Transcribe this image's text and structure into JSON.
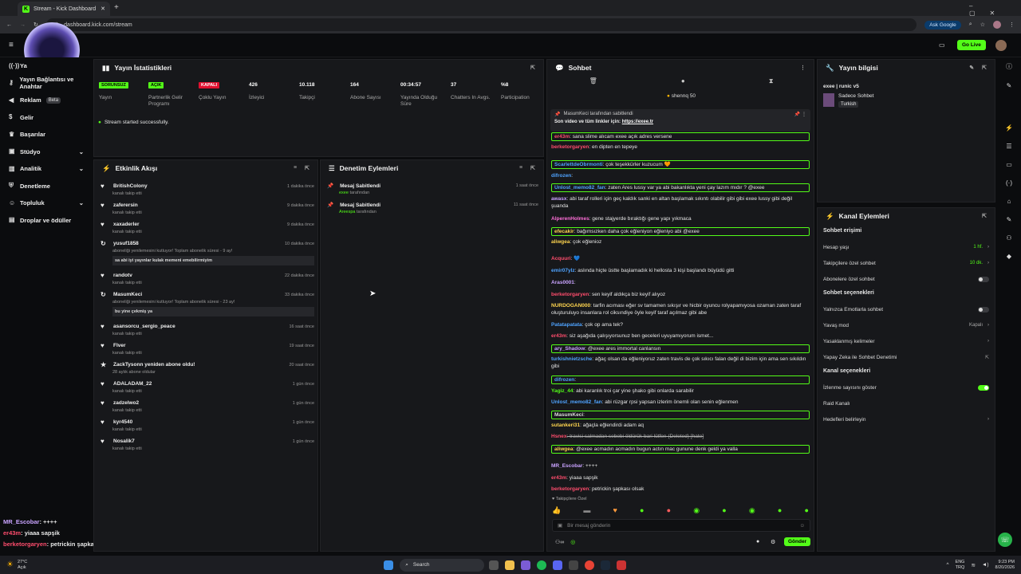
{
  "browser": {
    "tab_title": "Stream - Kick Dashboard",
    "url": "dashboard.kick.com/stream",
    "ask_google": "Ask Google"
  },
  "topbar": {
    "go_live": "Go Live"
  },
  "sidebar": {
    "items": [
      {
        "label": "Yayın Bağlantısı ve Anahtar",
        "icon": "key-icon"
      },
      {
        "label": "Reklam",
        "badge": "Beta",
        "icon": "megaphone-icon"
      },
      {
        "label": "Gelir",
        "icon": "dollar-icon"
      },
      {
        "label": "Başarılar",
        "icon": "trophy-icon"
      },
      {
        "label": "Stüdyo",
        "icon": "studio-icon"
      },
      {
        "label": "Analitik",
        "icon": "chart-icon"
      },
      {
        "label": "Denetleme",
        "icon": "shield-icon"
      },
      {
        "label": "Topluluk",
        "icon": "users-icon"
      },
      {
        "label": "Droplar ve ödüller",
        "icon": "gift-icon"
      }
    ],
    "chat_overlay": [
      {
        "user": "MR_Escobar",
        "text": ": ++++",
        "color": "#c9a3ff"
      },
      {
        "user": "er43m",
        "text": ": yiaaa sapşik",
        "color": "#ff4d6d"
      },
      {
        "user": "berketorgaryen",
        "text": ": petrickin şapkası olsak",
        "color": "#ff4d6d"
      }
    ]
  },
  "stats": {
    "title": "Yayın İstatistikleri",
    "items": [
      {
        "value": "SORUNSUZ",
        "label": "Yayın",
        "pill": "green"
      },
      {
        "value": "AÇIK",
        "label": "Partnerlik Gelir Programı",
        "pill": "green"
      },
      {
        "value": "KAPALI",
        "label": "Çoklu Yayın",
        "pill": "red"
      },
      {
        "value": "426",
        "label": "İzleyici"
      },
      {
        "value": "10.118",
        "label": "Takipçi"
      },
      {
        "value": "164",
        "label": "Abone Sayısı"
      },
      {
        "value": "00:34:57",
        "label": "Yayında Olduğu Süre"
      },
      {
        "value": "37",
        "label": "Chatters In Avgs."
      },
      {
        "value": "%8",
        "label": "Participation"
      }
    ],
    "success": "Stream started successfully."
  },
  "activity": {
    "title": "Etkinlik Akışı",
    "items": [
      {
        "name": "BritishColony",
        "sub": "kanalı takip etti",
        "time": "1 dakika önce"
      },
      {
        "name": "zaferersin",
        "sub": "kanalı takip etti",
        "time": "9 dakika önce"
      },
      {
        "name": "xaxaderler",
        "sub": "kanalı takip etti",
        "time": "9 dakika önce"
      },
      {
        "name": "yusuf1858",
        "sub": "aboneliği yenilemesini kutluyor! Toplam abonelik süresi - 9 ay!",
        "time": "10 dakika önce",
        "msg": "sa abi iyi yayınlar kulak memeni emebilirmiyim"
      },
      {
        "name": "randotv",
        "sub": "kanalı takip etti",
        "time": "22 dakika önce"
      },
      {
        "name": "MasumKeci",
        "sub": "aboneliği yenilemesini kutluyor! Toplam abonelik süresi - 23 ay!",
        "time": "33 dakika önce",
        "msg": "bu yine çekmiş ya"
      },
      {
        "name": "asansorcu_sergio_peace",
        "sub": "kanalı takip etti",
        "time": "16 saat önce"
      },
      {
        "name": "Flver",
        "sub": "kanalı takip etti",
        "time": "19 saat önce"
      },
      {
        "name": "ZackTysonn yeniden abone oldu!",
        "sub": "28 aylık abone oldular",
        "time": "20 saat önce"
      },
      {
        "name": "ADALADAM_22",
        "sub": "kanalı takip etti",
        "time": "1 gün önce"
      },
      {
        "name": "zadzelwo2",
        "sub": "kanalı takip etti",
        "time": "1 gün önce"
      },
      {
        "name": "kyr4540",
        "sub": "kanalı takip etti",
        "time": "1 gün önce"
      },
      {
        "name": "Nosalik7",
        "sub": "kanalı takip etti",
        "time": "1 gün önce"
      }
    ]
  },
  "moderation": {
    "title": "Denetim Eylemleri",
    "items": [
      {
        "action": "Mesaj Sabitlendi",
        "by": "exee",
        "suffix": " tarafından",
        "time": "1 saat önce"
      },
      {
        "action": "Mesaj Sabitlendi",
        "by": "Areespa",
        "suffix": " tarafından",
        "time": "11 saat önce"
      }
    ]
  },
  "chat": {
    "title": "Sohbet",
    "gift": "shennq 50",
    "pinned_by": "MasumKeci tarafından sabitlendi",
    "pinned_text": "Son video ve tüm linkler için:",
    "pinned_link": "https://exee.tr",
    "lines": [
      {
        "u": "er43m",
        "t": ": sana slime alıcam exee açık adres versene",
        "c": "#ff4d6d",
        "hl": true
      },
      {
        "u": "berketorgaryen",
        "t": ": en dipten en tepeye",
        "c": "#ff4d6d"
      },
      {
        "u": "ScarlettdeObrmonti",
        "t": ": çok teşekkürler kuzucum 🧡",
        "c": "#4fa3ff",
        "hl": true
      },
      {
        "u": "difrozen",
        "t": ":",
        "c": "#4fa3ff"
      },
      {
        "u": "Unlost_memo82_fan",
        "t": ": zaten Ares lussy var ya abi bakanlıkta yeni çay lazım mıdır ? @exee",
        "c": "#4fa3ff",
        "hl": true
      },
      {
        "u": "awasx",
        "t": ": abi taraf rolleri için geç kaldık sanki en altan başlamak sıkıntı olabilir gibi gibi exee lussy gibi değil şuanda",
        "c": "#c9a3ff"
      },
      {
        "u": "AlperenHolmes",
        "t": ": gene stajyerde bıraktığı gene yapı yıkmaca",
        "c": "#ff6fd8"
      },
      {
        "u": "efecakir",
        "t": ": bağımsızken daha çok eğleniyon eğleniyo abi @exee",
        "c": "#ffd54f",
        "hl": true
      },
      {
        "u": "aliwgea",
        "t": ": çok eğlenioz",
        "c": "#ffd54f"
      },
      {
        "u": "Acquuri",
        "t": ": 💙",
        "c": "#ff4d6d"
      },
      {
        "u": "emir07ylz",
        "t": ": aslında hiçte üstte başlamadık ki hellosta 3 kişi başlandı büyüdü gitti",
        "c": "#4fa3ff"
      },
      {
        "u": "Aras0001",
        "t": ":",
        "c": "#c9a3ff"
      },
      {
        "u": "berketorgaryen",
        "t": ": sen keyif aldıkça biz keyif alıyoz",
        "c": "#ff4d6d"
      },
      {
        "u": "NURDOGAN000",
        "t": ": tarfin acıması eğer sv tamamen sıkışır ve hicbir oyuncu rolyapamıyosa ozaman zaten taraf oluşturuluyo insanlara rol ciksındiye öyle keyif taraf açılmaz gibi abe",
        "c": "#ffd54f"
      },
      {
        "u": "Patatapatata",
        "t": ": çok op ama tek?",
        "c": "#4fa3ff"
      },
      {
        "u": "er43m",
        "t": ": siz aşağıda çalışıyorsunuz ben geceleri uyuyamıyorum ismet...",
        "c": "#ff4d6d"
      },
      {
        "u": "ary_Shadow",
        "t": ": @exee ares immortal canlansın",
        "c": "#c9a3ff",
        "hl": true
      },
      {
        "u": "turkishnietzsche",
        "t": ": ağaç olsan da eğleniyoruz zaten travis de çok sıkıcı falan değil di bizim için ama sen sıkıldın gibi",
        "c": "#4fa3ff"
      },
      {
        "u": "difrozen",
        "t": ":",
        "c": "#4fa3ff",
        "hl": true
      },
      {
        "u": "Yagiz_44",
        "t": ": abi karanlık troi çar yine şhako gibi onlarda sarabilir",
        "c": "#53fc18"
      },
      {
        "u": "Unlost_memo82_fan",
        "t": ": abi rüzgar rpsi yapsan izlerim önemli olan senin eğlenmen",
        "c": "#4fa3ff"
      },
      {
        "u": "MasumKeci",
        "t": ":",
        "c": "#ddd",
        "hl": true
      },
      {
        "u": "sutankeri31",
        "t": ": ağaçla eğlendirdi adam aq",
        "c": "#ffd54f"
      },
      {
        "u": "Hsnex",
        "t": ": travisi salmadan sebebi öldürük bari lütfen (Deleted) [hate]",
        "c": "#ff4d6d",
        "del": true
      },
      {
        "u": "aliwgea",
        "t": ": @exee acmadın acmadın bugun actın mac gunune denk geldi ya valla",
        "c": "#ffd54f",
        "hl": true
      },
      {
        "u": "MR_Escobar",
        "t": ": ++++",
        "c": "#c9a3ff"
      },
      {
        "u": "er43m",
        "t": ": yiaaa sapşik",
        "c": "#ff4d6d"
      },
      {
        "u": "berketorgaryen",
        "t": ": petrickin şapkası olsak",
        "c": "#ff4d6d"
      }
    ],
    "followers_only": "Takipçilere Özel",
    "input_placeholder": "Bir mesaj gönderin",
    "send": "Gönder"
  },
  "stream_info": {
    "title": "Yayın bilgisi",
    "stream_title": "exee | runic v5",
    "category": "Sadece Sohbet",
    "language": "Turkish"
  },
  "channel_actions": {
    "title": "Kanal Eylemleri",
    "chat_access": "Sohbet erişimi",
    "access": [
      {
        "label": "Hesap yaşı",
        "value": "1 hf."
      },
      {
        "label": "Takipçilere özel sohbet",
        "value": "10 dk."
      },
      {
        "label": "Abonelere özel sohbet",
        "toggle": false
      }
    ],
    "chat_options": "Sohbet seçenekleri",
    "options": [
      {
        "label": "Yalnızca Emotlarla sohbet",
        "toggle": false
      },
      {
        "label": "Yavaş mod",
        "value": "Kapalı"
      },
      {
        "label": "Yasaklanmış kelimeler"
      },
      {
        "label": "Yapay Zeka ile Sohbet Denetimi"
      }
    ],
    "channel_options": "Kanal seçenekleri",
    "channel": [
      {
        "label": "İzlenme sayısını göster",
        "toggle": true
      },
      {
        "label": "Raid Kanalı"
      },
      {
        "label": "Hedefleri belirleyin"
      }
    ]
  },
  "taskbar": {
    "weather": "27°C",
    "weather_sub": "Açık",
    "search": "Search",
    "lang": "ENG",
    "lang2": "TRQ",
    "time": "9:23 PM",
    "date": "8/20/2026"
  }
}
